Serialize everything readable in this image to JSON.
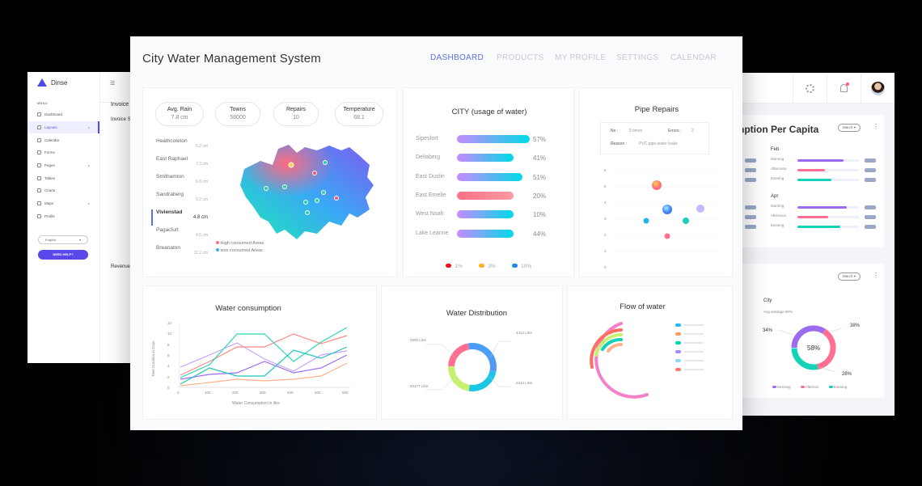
{
  "left_window": {
    "logo": "Dinse",
    "menu_title": "MENU",
    "nav_items": [
      {
        "label": "Dashboard",
        "arrow": ""
      },
      {
        "label": "Layouts",
        "arrow": "▸"
      },
      {
        "label": "Calendar",
        "arrow": ""
      },
      {
        "label": "Forms",
        "arrow": ""
      },
      {
        "label": "Pages",
        "arrow": "▸"
      },
      {
        "label": "Tables",
        "arrow": ""
      },
      {
        "label": "Charts",
        "arrow": ""
      },
      {
        "label": "Maps",
        "arrow": "▸"
      },
      {
        "label": "Profile",
        "arrow": ""
      }
    ],
    "language": "English",
    "help_button": "NEED HELP?",
    "invoice_label": "Invoice",
    "invoice_label2": "Invoice S",
    "revenue_label": "Revenue"
  },
  "right_window": {
    "title": "nption Per Capita",
    "month_select": "March",
    "months": [
      {
        "name": "Feb",
        "rows": [
          {
            "label": "Morning",
            "value": 0.75,
            "color": "#9b6cf0"
          },
          {
            "label": "Afternoon",
            "value": 0.45,
            "color": "#ff6f91"
          },
          {
            "label": "Evening",
            "value": 0.55,
            "color": "#14d2b8"
          }
        ]
      },
      {
        "name": "Apr",
        "rows": [
          {
            "label": "Morning",
            "value": 0.8,
            "color": "#9b6cf0"
          },
          {
            "label": "Afternoon",
            "value": 0.5,
            "color": "#ff6f91"
          },
          {
            "label": "Evening",
            "value": 0.7,
            "color": "#14d2b8"
          }
        ]
      }
    ],
    "month_select2": "March",
    "city_label": "City",
    "avg_wastage": "Avg wastage 58%",
    "donut_center": "58%",
    "donut_labels": [
      "34%",
      "38%",
      "28%"
    ],
    "donut_legend": [
      "Morning",
      "Afternon",
      "Evening"
    ],
    "donut_colors": [
      "#9b6cf0",
      "#ff6f91",
      "#14d2b8"
    ]
  },
  "main": {
    "title": "City Water Management System",
    "nav": [
      "DASHBOARD",
      "PRODUCTS",
      "MY PROFILE",
      "SETTINGS",
      "CALENDAR"
    ],
    "stats": [
      {
        "label": "Avg. Rain",
        "value": "7.8 cm"
      },
      {
        "label": "Towns",
        "value": "58000"
      },
      {
        "label": "Repairs",
        "value": "10"
      },
      {
        "label": "Temperature",
        "value": "68.1"
      }
    ],
    "towns": [
      {
        "name": "Heathcoteton",
        "value": "5.2 cm"
      },
      {
        "name": "East Raphael",
        "value": "7.3 cm"
      },
      {
        "name": "Smithamton",
        "value": "6.8 cm"
      },
      {
        "name": "Sandraberg",
        "value": "9.2 cm"
      },
      {
        "name": "Vivienstad",
        "value": "4.8 cm"
      },
      {
        "name": "Pagacfurt",
        "value": "4.5 cm"
      },
      {
        "name": "Breanaton",
        "value": "11.2 cm"
      }
    ],
    "map_legend": [
      "High consumed Areas",
      "less consumed Areas"
    ],
    "city_usage": {
      "title": "CITY (usage of water)",
      "rows": [
        {
          "name": "Sipesfort",
          "pct": "57%",
          "value": 57
        },
        {
          "name": "Deliaberg",
          "pct": "41%",
          "value": 41
        },
        {
          "name": "East Dustin",
          "pct": "51%",
          "value": 51
        },
        {
          "name": "East Emelie",
          "pct": "20%",
          "value": 20
        },
        {
          "name": "West Noah",
          "pct": "10%",
          "value": 10
        },
        {
          "name": "Lake Leanne",
          "pct": "44%",
          "value": 44
        }
      ],
      "legend": [
        "1%",
        "3%",
        "10%"
      ]
    },
    "pipe_repairs": {
      "title": "Pipe Repairs",
      "no_label": "No :",
      "no_value": "5 times",
      "errors_label": "Errors :",
      "errors_value": "2",
      "reason_label": "Reason :",
      "reason_value": "PVC pipe water leaks",
      "y_ticks": [
        "6",
        "5",
        "4",
        "3",
        "2",
        "1",
        "0"
      ]
    },
    "water_consumption": {
      "title": "Water consumption",
      "ylabel": "Time Duration in Days",
      "xlabel": "Water Consumption in litre",
      "x_ticks": [
        "0",
        "100",
        "200",
        "300",
        "400",
        "500",
        "600"
      ],
      "y_ticks": [
        "12",
        "10",
        "8",
        "6",
        "4",
        "2",
        "0"
      ]
    },
    "water_distribution": {
      "title": "Water Distribution",
      "labels": [
        "2500 Litre",
        "4312 Litre",
        "53177 Litre",
        "2343 Litre"
      ]
    },
    "flow_of_water": {
      "title": "Flow of water",
      "legend_colors": [
        "#2bb8f0",
        "#ff9966",
        "#00d4b4",
        "#a78bfa",
        "#8fd8f8",
        "#ff7b6b"
      ]
    }
  }
}
